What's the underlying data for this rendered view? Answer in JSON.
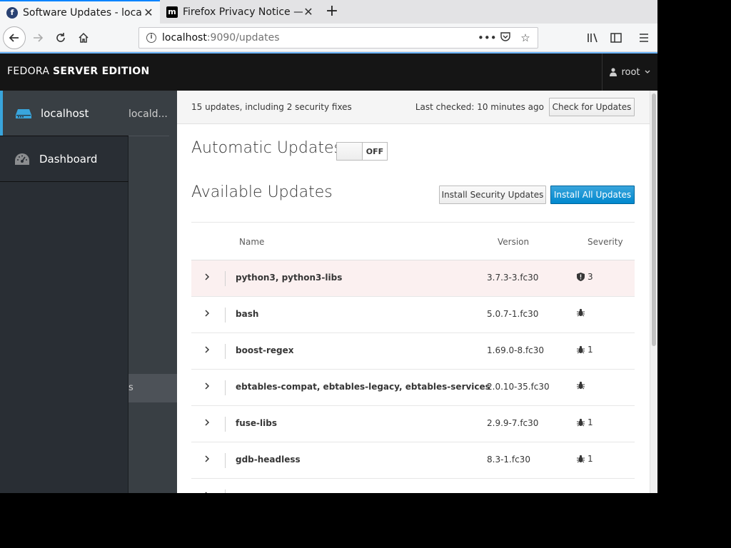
{
  "browser": {
    "tabs": [
      {
        "title": "Software Updates - localhost",
        "active": true
      },
      {
        "title": "Firefox Privacy Notice —",
        "active": false
      }
    ],
    "url": {
      "host": "localhost",
      "path": ":9090/updates"
    }
  },
  "header": {
    "brand_prefix": "FEDORA",
    "brand_suffix": "SERVER EDITION",
    "user": "root"
  },
  "hosts": [
    {
      "label": "localhost",
      "active": true,
      "icon": "server-icon"
    },
    {
      "label": "Dashboard",
      "active": false,
      "icon": "dashboard-icon"
    }
  ],
  "nav": {
    "ghost_text": "locald...",
    "selected_text": "s"
  },
  "updates": {
    "summary": "15 updates, including 2 security fixes",
    "last_checked": "Last checked: 10 minutes ago",
    "check_button": "Check for Updates",
    "auto_title": "Automatic Updates",
    "auto_state": "OFF",
    "available_title": "Available Updates",
    "install_security": "Install Security Updates",
    "install_all": "Install All Updates",
    "columns": {
      "name": "Name",
      "version": "Version",
      "severity": "Severity"
    },
    "rows": [
      {
        "name": "python3, python3-libs",
        "version": "3.7.3-3.fc30",
        "severity": "security",
        "count": "3"
      },
      {
        "name": "bash",
        "version": "5.0.7-1.fc30",
        "severity": "bug",
        "count": ""
      },
      {
        "name": "boost-regex",
        "version": "1.69.0-8.fc30",
        "severity": "bug",
        "count": "1"
      },
      {
        "name": "ebtables-compat, ebtables-legacy, ebtables-services",
        "version": "2.0.10-35.fc30",
        "severity": "bug",
        "count": ""
      },
      {
        "name": "fuse-libs",
        "version": "2.9.9-7.fc30",
        "severity": "bug",
        "count": "1"
      },
      {
        "name": "gdb-headless",
        "version": "8.3-1.fc30",
        "severity": "bug",
        "count": "1"
      }
    ]
  },
  "colors": {
    "accent": "#0088ce",
    "header_bg": "#151515",
    "sidebar_bg": "#292e34",
    "highlight_row": "#fbf0f0"
  }
}
